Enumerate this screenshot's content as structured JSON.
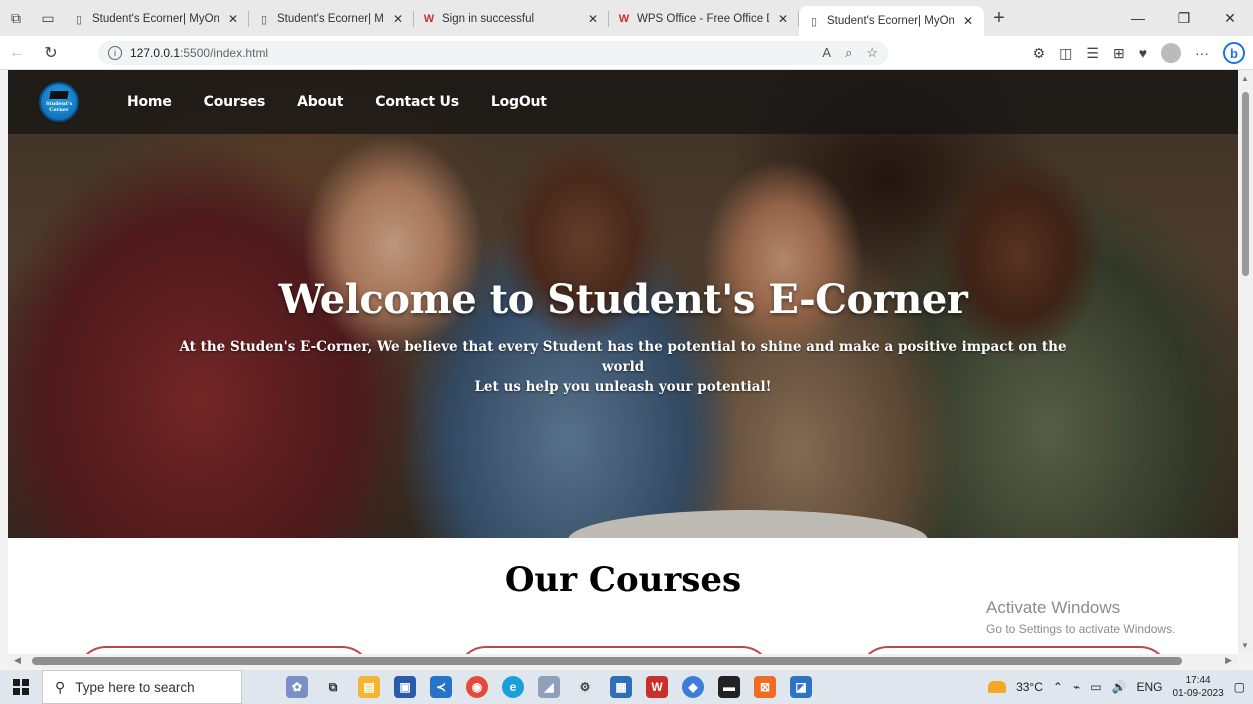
{
  "browser": {
    "tabs": [
      {
        "title": "Student's Ecorner| MyOnline",
        "icon": "page-icon",
        "active": false
      },
      {
        "title": "Student's Ecorner| MyOnline",
        "icon": "page-icon",
        "active": false
      },
      {
        "title": "Sign in successful",
        "icon": "wps-icon",
        "active": false
      },
      {
        "title": "WPS Office - Free Office Do",
        "icon": "wps-icon",
        "active": false
      },
      {
        "title": "Student's Ecorner| MyOnline",
        "icon": "page-icon",
        "active": true
      }
    ],
    "url_host": "127.0.0.1",
    "url_path": ":5500/index.html"
  },
  "site": {
    "logo_text_1": "Student's",
    "logo_text_2": "Corner",
    "nav": [
      "Home",
      "Courses",
      "About",
      "Contact Us",
      "LogOut"
    ],
    "hero": {
      "title": "Welcome to Student's E-Corner",
      "line1": "At the Studen's E-Corner, We believe that every Student has the potential to shine and make a positive impact on the world",
      "line2": "Let us help you unleash your potential!"
    },
    "section_title": "Our Courses"
  },
  "watermark": {
    "line1": "Activate Windows",
    "line2": "Go to Settings to activate Windows."
  },
  "taskbar": {
    "search_placeholder": "Type here to search",
    "weather": "33°C",
    "lang": "ENG",
    "time": "17:44",
    "date": "01-09-2023"
  }
}
